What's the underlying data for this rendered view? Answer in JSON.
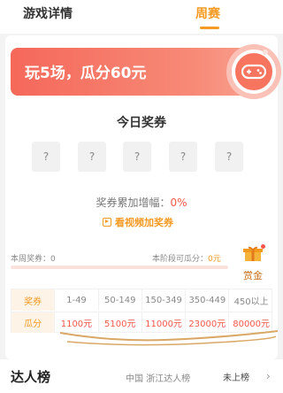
{
  "tabs": [
    "游戏详情",
    "周赛"
  ],
  "banner": {
    "title": "玩5场，瓜分60元"
  },
  "section_title": "今日奖券",
  "coupons": [
    "?",
    "?",
    "?",
    "?",
    "?"
  ],
  "accum": {
    "label": "奖券累加增幅：",
    "value": "0%"
  },
  "video_button": "看视频加奖券",
  "stats": {
    "weekly_label": "本周奖券：",
    "weekly_value": "0",
    "stage_label": "本阶段可瓜分：",
    "stage_value": "0元"
  },
  "progress": 0,
  "reward_label": "赏金",
  "table": {
    "row1": [
      "奖券",
      "1-49",
      "50-149",
      "150-349",
      "350-449",
      "450以上"
    ],
    "row2": [
      "瓜分",
      "1100元",
      "5100元",
      "11000元",
      "23000元",
      "80000元"
    ]
  },
  "bottom": {
    "title": "达人榜",
    "region": "中国 浙江达人榜",
    "status": "未上榜"
  },
  "colors": {
    "accent": "#f59a23",
    "red": "#f5584a"
  }
}
